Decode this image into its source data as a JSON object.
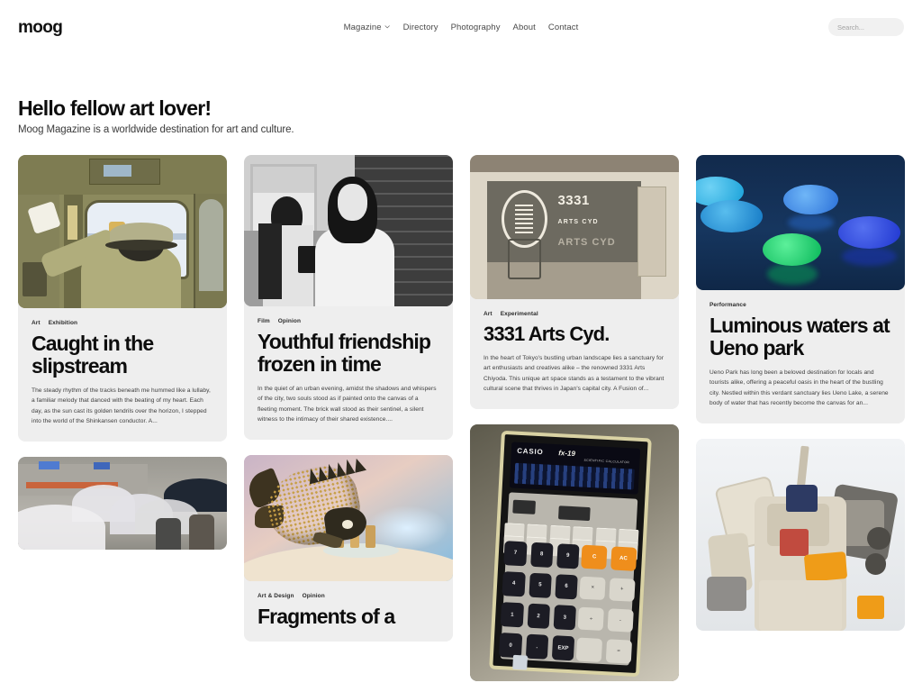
{
  "header": {
    "logo": "moog",
    "nav": [
      {
        "label": "Magazine",
        "has_dropdown": true
      },
      {
        "label": "Directory",
        "has_dropdown": false
      },
      {
        "label": "Photography",
        "has_dropdown": false
      },
      {
        "label": "About",
        "has_dropdown": false
      },
      {
        "label": "Contact",
        "has_dropdown": false
      }
    ],
    "search": {
      "value": "",
      "placeholder": "Search..."
    }
  },
  "hero": {
    "title": "Hello fellow art lover!",
    "subtitle": "Moog Magazine is a worldwide destination for art and culture."
  },
  "cards": {
    "slipstream": {
      "tags": [
        "Art",
        "Exhibition"
      ],
      "title": "Caught in the slipstream",
      "excerpt": "The steady rhythm of the tracks beneath me hummed like a lullaby, a familiar melody that danced with the beating of my heart. Each day, as the sun cast its golden tendrils over the horizon, I stepped into the world of the Shinkansen conductor. A...",
      "image_alt": "train-conductor-photo"
    },
    "umbrellas": {
      "image_alt": "transparent-umbrellas-in-rain-photo"
    },
    "youthful": {
      "tags": [
        "Film",
        "Opinion"
      ],
      "title": "Youthful friendship frozen in time",
      "excerpt": "In the quiet of an urban evening, amidst the shadows and whispers of the city, two souls stood as if painted onto the canvas of a fleeting moment. The brick wall stood as their sentinel, a silent witness to the intimacy of their shared existence....",
      "image_alt": "two-women-brick-wall-bw-photo"
    },
    "fragments": {
      "tags": [
        "Art & Design",
        "Opinion"
      ],
      "title": "Fragments of a",
      "image_alt": "golden-fish-sculpture-photo"
    },
    "arts3331": {
      "tags": [
        "Art",
        "Experimental"
      ],
      "title": "3331 Arts Cyd.",
      "excerpt": "In the heart of Tokyo's bustling urban landscape lies a sanctuary for art enthusiasts and creatives alike – the renowned 3331 Arts Chiyoda. This unique art space stands as a testament to the vibrant cultural scene that thrives in Japan's capital city. A Fusion of...",
      "image_alt": "3331-arts-chiyoda-storefront-photo",
      "storefront_text": {
        "number": "3331",
        "line2": "ARTS CYD",
        "line3": "ARTS CYD"
      }
    },
    "calculator": {
      "image_alt": "casio-fx-19-scientific-calculator-photo",
      "device": {
        "brand": "CASIO",
        "model": "fx-19",
        "subtitle": "SCIENTIFIC CALCULATOR"
      },
      "keys": {
        "numpad": [
          "7",
          "8",
          "9",
          "4",
          "5",
          "6",
          "1",
          "2",
          "3",
          "0",
          ".",
          "EXP"
        ],
        "ops": [
          "C",
          "AC",
          "×",
          "+",
          "÷",
          "-",
          "",
          "="
        ]
      }
    },
    "luminous": {
      "tags": [
        "Performance"
      ],
      "title": "Luminous waters at Ueno park",
      "excerpt": "Ueno Park has long been a beloved destination for locals and tourists alike, offering a peaceful oasis in the heart of the bustling city. Nestled within this verdant sanctuary lies Ueno Lake, a serene body of water that has recently become the canvas for an...",
      "image_alt": "glowing-orbs-on-water-photo"
    },
    "gundam": {
      "image_alt": "gundam-statue-photo"
    }
  },
  "colors": {
    "card_background": "#eeeeee",
    "page_background": "#ffffff",
    "text_primary": "#0d0d0d",
    "text_secondary": "#3d3d3d",
    "search_background": "#f1f1f1",
    "accent_orange": "#ef8e1c"
  }
}
